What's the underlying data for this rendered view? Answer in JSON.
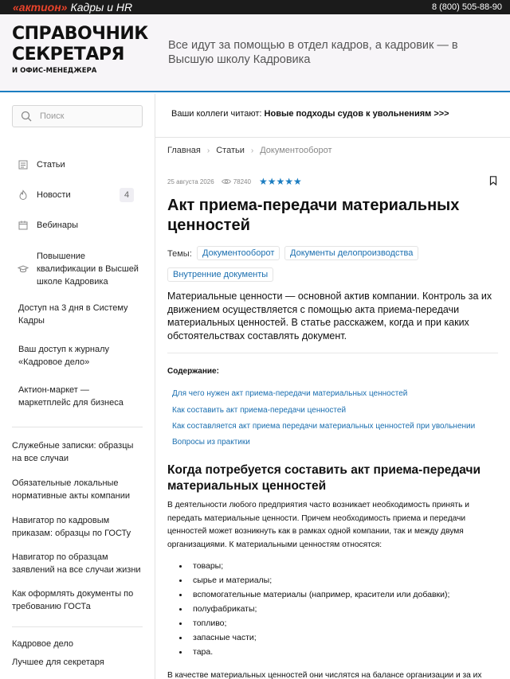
{
  "topbar": {
    "brand": "«актион»",
    "brand_sub": "Кадры и HR",
    "phone": "8 (800) 505-88-90"
  },
  "header": {
    "logo_line1": "СПРАВОЧНИК",
    "logo_line2": "СЕКРЕТАРЯ",
    "logo_line3": "И ОФИС-МЕНЕДЖЕРА",
    "tagline": "Все идут за помощью в отдел кадров, а кадровик — в Высшую школу Кадровика"
  },
  "sidebar": {
    "search_placeholder": "Поиск",
    "nav": [
      {
        "label": "Статьи",
        "icon": "article-icon"
      },
      {
        "label": "Новости",
        "icon": "fire-icon",
        "badge": "4"
      },
      {
        "label": "Вебинары",
        "icon": "calendar-icon"
      },
      {
        "label": "Повышение квалификации в Высшей школе Кадровика",
        "icon": "graduation-cap-icon"
      }
    ],
    "links_group1": [
      "Доступ на 3 дня в Систему Кадры",
      "Ваш доступ к журналу «Кадровое дело»",
      "Актион-маркет — маркетплейс для бизнеса"
    ],
    "links_group2": [
      "Служебные записки: образцы на все случаи",
      "Обязательные локальные нормативные акты компании",
      "Навигатор по кадровым приказам: образцы по ГОСТу",
      "Навигатор по образцам заявлений на все случаи жизни",
      "Как оформлять документы по требованию ГОСТа"
    ],
    "links_group3": [
      "Кадровое дело",
      "Лучшее для секретаря"
    ]
  },
  "promo": {
    "prefix": "Ваши коллеги читают: ",
    "link": "Новые подходы судов к увольнениям >>>"
  },
  "breadcrumbs": [
    "Главная",
    "Статьи",
    "Документооборот"
  ],
  "article": {
    "date": "25 августа 2026",
    "views": "78240",
    "rating": "★★★★★",
    "title": "Акт приема-передачи материальных ценностей",
    "themes_label": "Темы:",
    "themes": [
      "Документооборот",
      "Документы делопроизводства",
      "Внутренние документы"
    ],
    "lead": "Материальные ценности — основной актив компании. Контроль за их движением осуществляется с помощью акта приема-передачи материальных ценностей. В статье расскажем, когда и при каких обстоятельствах составлять документ.",
    "toc_title": "Содержание:",
    "toc": [
      "Для чего нужен акт приема-передачи материальных ценностей",
      "Как составить акт приема-передачи ценностей",
      "Как составляется акт приема передачи материальных ценностей при увольнении",
      "Вопросы из практики"
    ],
    "section1_title": "Когда потребуется составить акт приема-передачи материальных ценностей",
    "section1_para": "В деятельности любого предприятия часто возникает необходимость принять и передать материальные ценности. Причем необходимость приема и передачи ценностей может возникнуть как в рамках одной компании, так и между двумя организациями. К материальными ценностям относятся:",
    "bullets": [
      "товары;",
      "сырье и материалы;",
      "вспомогательные материалы (например, красители или добавки);",
      "полуфабрикаты;",
      "топливо;",
      "запасные части;",
      "тара."
    ],
    "section1_tail": "В качестве материальных ценностей они числятся на балансе организации и за их"
  },
  "colors": {
    "accent": "#1b7dc1",
    "brand_red": "#e8432b",
    "topbar_bg": "#1b1b1b",
    "header_bg": "#f7f5f8"
  }
}
